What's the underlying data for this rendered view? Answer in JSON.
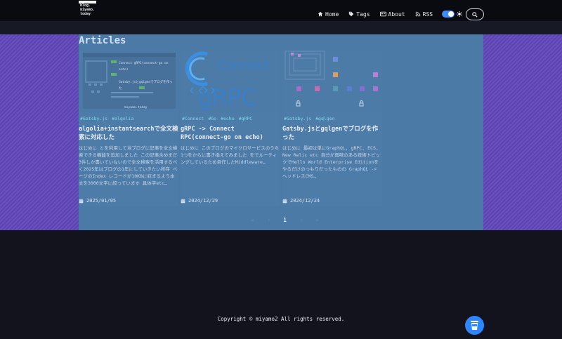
{
  "site": {
    "logo_lines": [
      "blog.",
      "miyamo.",
      "today"
    ]
  },
  "nav": {
    "items": [
      {
        "label": "Home",
        "icon": "home-icon"
      },
      {
        "label": "Tags",
        "icon": "tag-icon"
      },
      {
        "label": "About",
        "icon": "id-card-icon"
      },
      {
        "label": "RSS",
        "icon": "rss-icon"
      }
    ]
  },
  "main": {
    "title": "Articles",
    "cards": [
      {
        "tags": [
          "#Gatsby.js",
          "#algolia"
        ],
        "title": "algolia+instantsearchで全文検索に対応した",
        "excerpt": "はじめに とを利用して当ブログに記事を全文検索できる機能を追加しました この記事含めまだ3件しか書いていないので全文検索を活用するべく2025年はブログの1年にしていきたい所存 ページのIndex レコードが10KBに収まるよう本文を3000文字に絞っています 具体字etc…",
        "date": "2025/01/05",
        "thumb_lines": [
          "Connect gRPC(connect-go on echo)",
          "Gatsby.jsとgqlgenでブログを作った",
          "miyamo.today"
        ]
      },
      {
        "tags": [
          "#Connect",
          "#Go",
          "#echo",
          "#gRPC"
        ],
        "title": "gRPC -> Connect RPC(connect-go on echo)",
        "excerpt": "はじめに このブログのマイクロサービスのうち1つをからに書き換えてみました をでルーティングしているため自作したMiddleware…",
        "date": "2024/12/29",
        "thumb_lines": [
          "Connect",
          "gRPC"
        ]
      },
      {
        "tags": [
          "#Gatsby.js",
          "#gqlgen"
        ],
        "title": "Gatsby.jsとgqlgenでブログを作った",
        "excerpt": "はじめに 最初は単にGraphQL, gRPC, ECS, New Relic etc 自分が興味のある技術トピックでHello World Enterprise Editionをやるだけのつもりだったものの GraphQL -> ヘッドレスCMS…",
        "date": "2024/12/24",
        "thumb_lines": []
      }
    ]
  },
  "pagination": {
    "first": "«",
    "prev": "‹",
    "current": "1",
    "next": "›",
    "last": "»"
  },
  "footer": {
    "text": "Copyright © miyamo2 All rights reserved."
  },
  "colors": {
    "accent": "#2e86ff",
    "content_bg": "#4c7aa6",
    "side_bg": "#6a4fc2",
    "tag": "#7fd7ea"
  }
}
